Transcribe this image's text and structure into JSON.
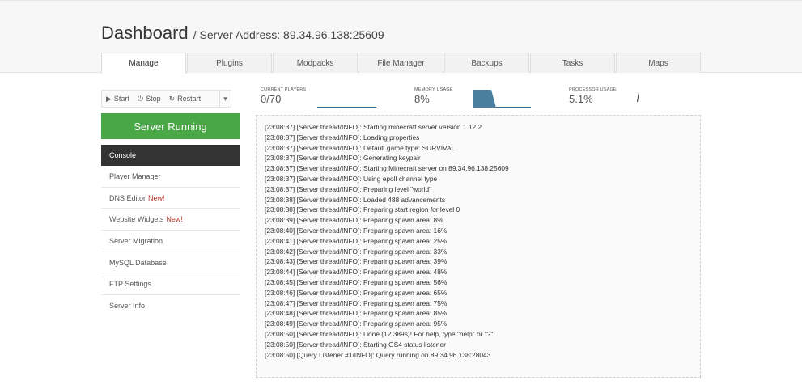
{
  "header": {
    "title": "Dashboard",
    "subtitle": "/ Server Address: 89.34.96.138:25609"
  },
  "tabs": [
    {
      "label": "Manage",
      "active": true
    },
    {
      "label": "Plugins"
    },
    {
      "label": "Modpacks"
    },
    {
      "label": "File Manager"
    },
    {
      "label": "Backups"
    },
    {
      "label": "Tasks"
    },
    {
      "label": "Maps"
    }
  ],
  "controls": {
    "start_label": "Start",
    "stop_label": "Stop",
    "restart_label": "Restart",
    "start_icon": "▶",
    "stop_icon": "⏻",
    "restart_icon": "↻",
    "dropdown_icon": "▾"
  },
  "status": {
    "label": "Server Running",
    "color": "#4aa745"
  },
  "sidebar": {
    "items": [
      {
        "label": "Console",
        "active": true
      },
      {
        "label": "Player Manager"
      },
      {
        "label": "DNS Editor",
        "badge": "New!"
      },
      {
        "label": "Website Widgets",
        "badge": "New!"
      },
      {
        "label": "Server Migration"
      },
      {
        "label": "MySQL Database"
      },
      {
        "label": "FTP Settings"
      },
      {
        "label": "Server Info"
      }
    ]
  },
  "stats": {
    "players": {
      "label": "CURRENT PLAYERS",
      "value": "0/70"
    },
    "memory": {
      "label": "MEMORY USAGE",
      "value": "8%"
    },
    "cpu": {
      "label": "PROCESSOR USAGE",
      "value": "5.1%"
    }
  },
  "colors": {
    "sparkline_fill": "#4a7fa0",
    "sparkline_line": "#2e6a96",
    "sidebar_active": "#333333",
    "new_badge": "#b7372f"
  },
  "console": {
    "lines": [
      "[23:08:37] [Server thread/INFO]: Starting minecraft server version 1.12.2",
      "[23:08:37] [Server thread/INFO]: Loading properties",
      "[23:08:37] [Server thread/INFO]: Default game type: SURVIVAL",
      "[23:08:37] [Server thread/INFO]: Generating keypair",
      "[23:08:37] [Server thread/INFO]: Starting Minecraft server on 89.34.96.138:25609",
      "[23:08:37] [Server thread/INFO]: Using epoll channel type",
      "[23:08:37] [Server thread/INFO]: Preparing level \"world\"",
      "[23:08:38] [Server thread/INFO]: Loaded 488 advancements",
      "[23:08:38] [Server thread/INFO]: Preparing start region for level 0",
      "[23:08:39] [Server thread/INFO]: Preparing spawn area: 8%",
      "[23:08:40] [Server thread/INFO]: Preparing spawn area: 16%",
      "[23:08:41] [Server thread/INFO]: Preparing spawn area: 25%",
      "[23:08:42] [Server thread/INFO]: Preparing spawn area: 33%",
      "[23:08:43] [Server thread/INFO]: Preparing spawn area: 39%",
      "[23:08:44] [Server thread/INFO]: Preparing spawn area: 48%",
      "[23:08:45] [Server thread/INFO]: Preparing spawn area: 56%",
      "[23:08:46] [Server thread/INFO]: Preparing spawn area: 65%",
      "[23:08:47] [Server thread/INFO]: Preparing spawn area: 75%",
      "[23:08:48] [Server thread/INFO]: Preparing spawn area: 85%",
      "[23:08:49] [Server thread/INFO]: Preparing spawn area: 95%",
      "[23:08:50] [Server thread/INFO]: Done (12.389s)! For help, type \"help\" or \"?\"",
      "[23:08:50] [Server thread/INFO]: Starting GS4 status listener",
      "[23:08:50] [Query Listener #1/INFO]: Query running on 89.34.96.138:28043"
    ]
  }
}
